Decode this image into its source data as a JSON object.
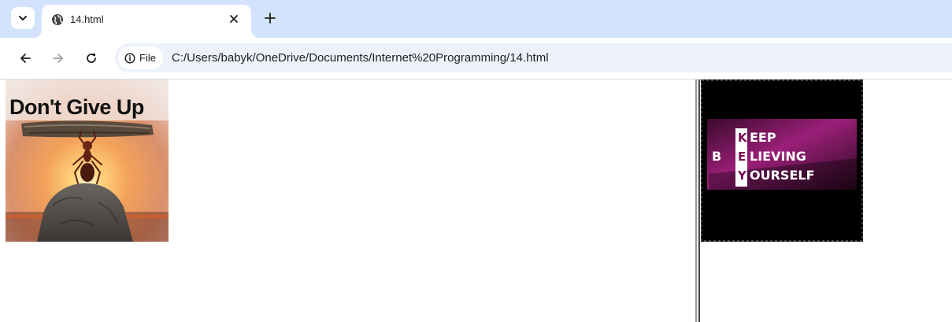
{
  "browser": {
    "tab": {
      "title": "14.html",
      "favicon": "globe-icon"
    },
    "chip_label": "File",
    "url": "C:/Users/babyk/OneDrive/Documents/Internet%20Programming/14.html"
  },
  "left_image": {
    "text": "Don't Give Up"
  },
  "right_image": {
    "vertical_word": [
      "K",
      "E",
      "Y"
    ],
    "line1_rest": "EEP",
    "line2_prefix": "B",
    "line2_rest": "LIEVING",
    "line3_rest": "OURSELF"
  },
  "colors": {
    "tabstrip_bg": "#d3e3fd",
    "omnibox_bg": "#edf2fa",
    "poster_magenta": "#8a1a6a"
  }
}
